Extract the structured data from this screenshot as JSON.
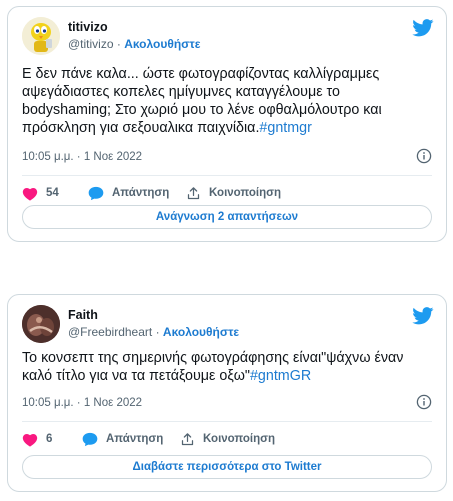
{
  "tweets": [
    {
      "name": "titivizo",
      "handle": "@titivizo",
      "separator": "·",
      "follow_label": "Ακολουθήστε",
      "text": "Ε δεν πάνε καλα... ώστε φωτογραφίζοντας καλλίγραμμες αψεγάδιαστες κοπελες  ημίγυμνες καταγγέλουμε το bodyshaming; Στο χωριό μου το λένε οφθαλμόλουτρο και πρόσκληση για σεξουαλικα παιχνίδια.",
      "hashtag": "#gntmgr",
      "time": "10:05 μ.μ. · 1 Νοε 2022",
      "likes": "54",
      "reply_label": "Απάντηση",
      "share_label": "Κοινοποίηση",
      "button_label": "Ανάγνωση 2 απαντήσεων"
    },
    {
      "name": "Faith",
      "handle": "@Freebirdheart",
      "separator": "·",
      "follow_label": "Ακολουθήστε",
      "text": "Το κονσεπτ της σημερινής φωτογράφησης είναι\"ψάχνω έναν καλό τίτλο για να τα πετάξουμε οξω\"",
      "hashtag": "#gntmGR",
      "time": "10:05 μ.μ. · 1 Νοε 2022",
      "likes": "6",
      "reply_label": "Απάντηση",
      "share_label": "Κοινοποίηση",
      "button_label": "Διαβάστε περισσότερα στο Twitter"
    }
  ],
  "colors": {
    "accent": "#1d7bd0",
    "like": "#f91880",
    "text": "#0f1419",
    "muted": "#536471",
    "border": "#cfd9de"
  },
  "icons": [
    "twitter-bird-icon",
    "info-icon",
    "heart-icon",
    "reply-bubble-icon",
    "share-icon"
  ]
}
